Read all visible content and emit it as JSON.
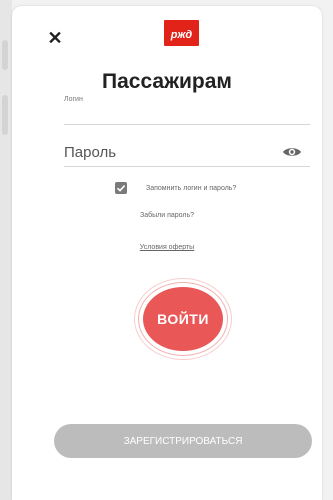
{
  "header": {
    "close_icon": "close-icon",
    "logo": "РЖД",
    "title": "Пассажирам"
  },
  "form": {
    "login_label": "Логин",
    "password_placeholder": "Пароль",
    "show_password_icon": "eye-icon",
    "remember_checked": true,
    "remember_label": "Запомнить логин и пароль?",
    "forgot_link": "Забыли пароль?",
    "offer_link": "Условия оферты"
  },
  "actions": {
    "login_button": "ВОЙТИ",
    "register_button": "ЗАРЕГИСТРИРОВАТЬСЯ"
  },
  "colors": {
    "brand_red": "#e2231a",
    "login_button": "#e95757",
    "register_button": "#bcbcbc"
  }
}
